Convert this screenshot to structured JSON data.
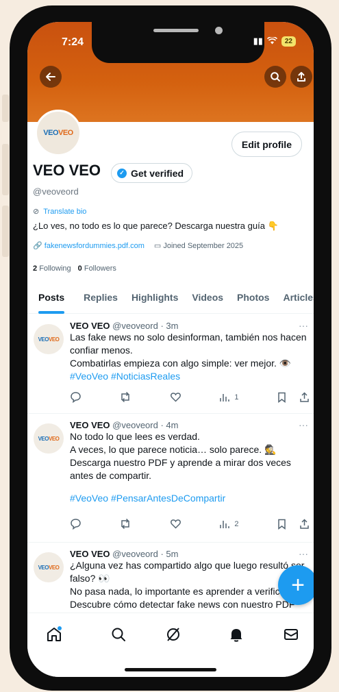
{
  "status_bar": {
    "time": "7:24",
    "battery": "22"
  },
  "profile": {
    "avatar_logo_part1": "VEO",
    "avatar_logo_part2": "VEO",
    "edit_profile_label": "Edit profile",
    "name": "VEO VEO",
    "get_verified_label": "Get verified",
    "handle": "@veoveord",
    "translate_bio_label": "Translate bio",
    "bio": "¿Lo ves, no todo es lo que parece? Descarga nuestra guía 👇",
    "website": "fakenewsfordummies.pdf.com",
    "joined": "Joined September 2025",
    "following_count": "2",
    "following_label": "Following",
    "followers_count": "0",
    "followers_label": "Followers"
  },
  "tabs": [
    {
      "label": "Posts"
    },
    {
      "label": "Replies"
    },
    {
      "label": "Highlights"
    },
    {
      "label": "Videos"
    },
    {
      "label": "Photos"
    },
    {
      "label": "Articles"
    }
  ],
  "tweets": [
    {
      "name": "VEO VEO",
      "handle_time": "@veoveord · 3m",
      "lines": [
        "Las fake news no solo desinforman, también nos hacen confiar menos.",
        "Combatirlas empieza con algo simple: ver mejor. 👁️"
      ],
      "tags": "#VeoVeo #NoticiasReales",
      "views": "1"
    },
    {
      "name": "VEO VEO",
      "handle_time": "@veoveord · 4m",
      "lines": [
        "No todo lo que lees es verdad.",
        "A veces, lo que parece noticia… solo parece. 🕵️",
        "Descarga nuestro PDF y aprende a mirar dos veces antes de compartir."
      ],
      "tags": "#VeoVeo #PensarAntesDeCompartir",
      "views": "2"
    },
    {
      "name": "VEO VEO",
      "handle_time": "@veoveord · 5m",
      "lines": [
        "¿Alguna vez has compartido algo que luego resultó ser falso? 👀",
        "No pasa nada, lo importante es aprender a verificar.",
        "Descubre cómo detectar fake news con nuestro PDF"
      ],
      "tags": "",
      "views": ""
    }
  ],
  "icons": {
    "back": "arrow-left-icon",
    "search": "search-icon",
    "share": "share-icon",
    "compose": "plus-icon",
    "nav": [
      "home-icon",
      "search-icon",
      "grok-icon",
      "notifications-icon",
      "messages-icon"
    ]
  },
  "colors": {
    "banner": "#d4610f",
    "accent": "#1d9bf0"
  }
}
